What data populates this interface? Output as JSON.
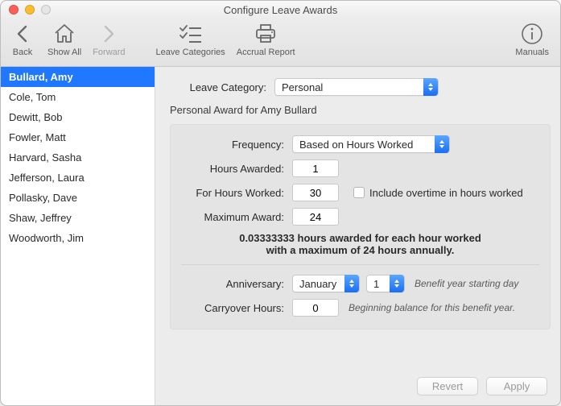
{
  "window": {
    "title": "Configure Leave Awards"
  },
  "toolbar": {
    "back": "Back",
    "show_all": "Show All",
    "forward": "Forward",
    "leave_categories": "Leave Categories",
    "accrual_report": "Accrual Report",
    "manuals": "Manuals"
  },
  "sidebar": {
    "items": [
      {
        "name": "Bullard, Amy",
        "selected": true
      },
      {
        "name": "Cole, Tom"
      },
      {
        "name": "Dewitt, Bob"
      },
      {
        "name": "Fowler, Matt"
      },
      {
        "name": "Harvard, Sasha"
      },
      {
        "name": "Jefferson, Laura"
      },
      {
        "name": "Pollasky, Dave"
      },
      {
        "name": "Shaw, Jeffrey"
      },
      {
        "name": "Woodworth, Jim"
      }
    ]
  },
  "main": {
    "leave_category_label": "Leave Category:",
    "leave_category_value": "Personal",
    "award_title": "Personal Award for Amy Bullard",
    "frequency_label": "Frequency:",
    "frequency_value": "Based on Hours Worked",
    "hours_awarded_label": "Hours Awarded:",
    "hours_awarded_value": "1",
    "for_hours_worked_label": "For Hours Worked:",
    "for_hours_worked_value": "30",
    "include_ot_label": "Include overtime in hours worked",
    "max_award_label": "Maximum Award:",
    "max_award_value": "24",
    "summary_line1": "0.03333333 hours awarded for each hour worked",
    "summary_line2": "with a maximum of 24 hours annually.",
    "anniversary_label": "Anniversary:",
    "anniversary_month": "January",
    "anniversary_day": "1",
    "anniversary_hint": "Benefit year starting day",
    "carryover_label": "Carryover Hours:",
    "carryover_value": "0",
    "carryover_hint": "Beginning balance for this benefit year."
  },
  "footer": {
    "revert": "Revert",
    "apply": "Apply"
  }
}
